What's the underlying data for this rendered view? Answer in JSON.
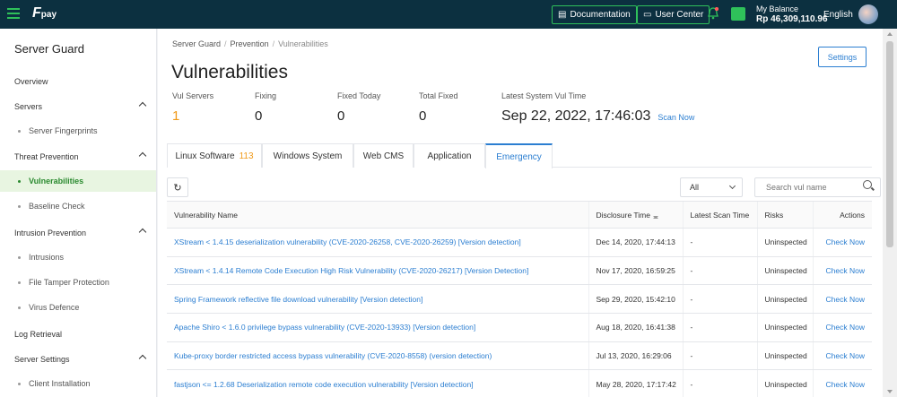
{
  "topbar": {
    "logo_text": "F",
    "logo_sub": "pay",
    "documentation": "Documentation",
    "user_center": "User Center",
    "balance_label": "My Balance",
    "balance_value": "Rp 46,309,110.96",
    "language": "English"
  },
  "sidebar": {
    "title": "Server Guard",
    "items": [
      {
        "label": "Overview"
      },
      {
        "label": "Servers"
      },
      {
        "label": "Server Fingerprints"
      },
      {
        "label": "Threat Prevention"
      },
      {
        "label": "Vulnerabilities"
      },
      {
        "label": "Baseline Check"
      },
      {
        "label": "Intrusion Prevention"
      },
      {
        "label": "Intrusions"
      },
      {
        "label": "File Tamper Protection"
      },
      {
        "label": "Virus Defence"
      },
      {
        "label": "Log Retrieval"
      },
      {
        "label": "Server Settings"
      },
      {
        "label": "Client Installation"
      }
    ]
  },
  "breadcrumb": [
    "Server Guard",
    "Prevention",
    "Vulnerabilities"
  ],
  "page_title": "Vulnerabilities",
  "settings_label": "Settings",
  "stats": {
    "vul_servers": {
      "label": "Vul Servers",
      "value": "1"
    },
    "fixing": {
      "label": "Fixing",
      "value": "0"
    },
    "fixed_today": {
      "label": "Fixed Today",
      "value": "0"
    },
    "total_fixed": {
      "label": "Total Fixed",
      "value": "0"
    },
    "latest_time": {
      "label": "Latest System Vul Time",
      "value": "Sep 22, 2022, 17:46:03"
    },
    "scan_now": "Scan Now"
  },
  "tabs": [
    {
      "label": "Linux Software",
      "count": "113"
    },
    {
      "label": "Windows System"
    },
    {
      "label": "Web CMS"
    },
    {
      "label": "Application"
    },
    {
      "label": "Emergency"
    }
  ],
  "filter": {
    "value": "All"
  },
  "search": {
    "placeholder": "Search vul name"
  },
  "table": {
    "headers": [
      "Vulnerability Name",
      "Disclosure Time",
      "Latest Scan Time",
      "Risks",
      "Actions"
    ],
    "rows": [
      {
        "name": "XStream < 1.4.15 deserialization vulnerability (CVE-2020-26258, CVE-2020-26259) [Version detection]",
        "disclosure": "Dec 14, 2020, 17:44:13",
        "scan": "-",
        "risk": "Uninspected",
        "action": "Check Now"
      },
      {
        "name": "XStream < 1.4.14 Remote Code Execution High Risk Vulnerability (CVE-2020-26217) [Version Detection]",
        "disclosure": "Nov 17, 2020, 16:59:25",
        "scan": "-",
        "risk": "Uninspected",
        "action": "Check Now"
      },
      {
        "name": "Spring Framework reflective file download vulnerability [Version detection]",
        "disclosure": "Sep 29, 2020, 15:42:10",
        "scan": "-",
        "risk": "Uninspected",
        "action": "Check Now"
      },
      {
        "name": "Apache Shiro < 1.6.0 privilege bypass vulnerability (CVE-2020-13933) [Version detection]",
        "disclosure": "Aug 18, 2020, 16:41:38",
        "scan": "-",
        "risk": "Uninspected",
        "action": "Check Now"
      },
      {
        "name": "Kube-proxy border restricted access bypass vulnerability (CVE-2020-8558) (version detection)",
        "disclosure": "Jul 13, 2020, 16:29:06",
        "scan": "-",
        "risk": "Uninspected",
        "action": "Check Now"
      },
      {
        "name": "fastjson <= 1.2.68 Deserialization remote code execution vulnerability [Version detection]",
        "disclosure": "May 28, 2020, 17:17:42",
        "scan": "-",
        "risk": "Uninspected",
        "action": "Check Now"
      }
    ]
  },
  "colors": {
    "topbar": "#0c3040",
    "accent_green": "#2fc15a",
    "link_blue": "#2b7ed1",
    "orange": "#f09a1a"
  }
}
